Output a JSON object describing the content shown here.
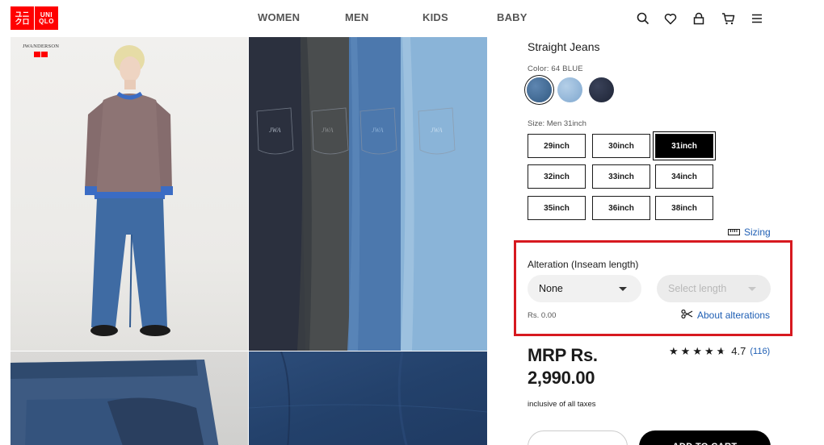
{
  "header": {
    "logo": {
      "jp_line1": "ユニ",
      "jp_line2": "クロ",
      "en_line1": "UNI",
      "en_line2": "QLO",
      "color": "#ff0000"
    },
    "nav": [
      "WOMEN",
      "MEN",
      "KIDS",
      "BABY"
    ],
    "icons": [
      "search-icon",
      "heart-icon",
      "account-icon",
      "cart-icon",
      "menu-icon"
    ]
  },
  "gallery": {
    "brand_badge": "JWANDERSON",
    "jeans_tag": "JWA"
  },
  "product": {
    "title": "Straight Jeans",
    "color_label": "Color: 64 BLUE",
    "colors": [
      {
        "name": "64 BLUE",
        "hex": "#3f6790",
        "selected": true
      },
      {
        "name": "light blue",
        "hex": "#8fb3d6",
        "selected": false
      },
      {
        "name": "navy",
        "hex": "#262d40",
        "selected": false
      }
    ],
    "size_label": "Size: Men 31inch",
    "sizes": [
      {
        "label": "29inch",
        "selected": false
      },
      {
        "label": "30inch",
        "selected": false
      },
      {
        "label": "31inch",
        "selected": true
      },
      {
        "label": "32inch",
        "selected": false
      },
      {
        "label": "33inch",
        "selected": false
      },
      {
        "label": "34inch",
        "selected": false
      },
      {
        "label": "35inch",
        "selected": false
      },
      {
        "label": "36inch",
        "selected": false
      },
      {
        "label": "38inch",
        "selected": false
      }
    ],
    "sizing_link": "Sizing"
  },
  "alteration": {
    "title": "Alteration (Inseam length)",
    "type_value": "None",
    "length_placeholder": "Select length",
    "price": "Rs. 0.00",
    "about_link": "About alterations",
    "highlight_color": "#d71920"
  },
  "pricing": {
    "prefix": "MRP Rs.",
    "amount": "2,990.00",
    "tax_note": "inclusive of all taxes",
    "rating": {
      "score": "4.7",
      "count": "(116)",
      "stars": 4.7
    }
  },
  "purchase": {
    "add_to_cart": "ADD TO CART"
  }
}
